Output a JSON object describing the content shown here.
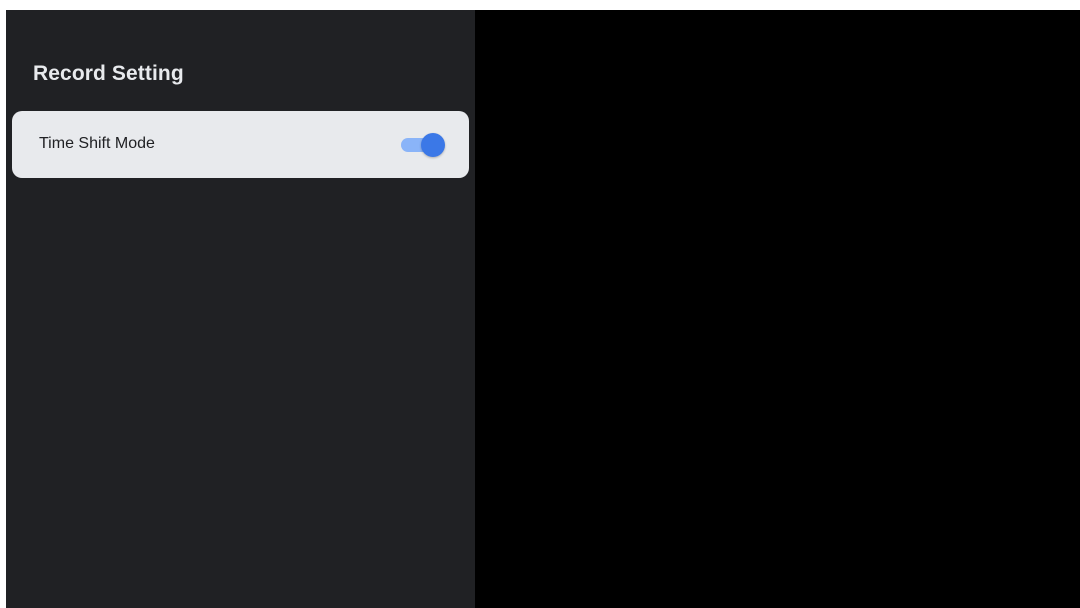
{
  "panel": {
    "title": "Record Setting",
    "settings": [
      {
        "label": "Time Shift Mode",
        "toggle_on": true
      }
    ]
  },
  "colors": {
    "panel_background": "#202124",
    "row_focused_background": "#e8eaed",
    "toggle_track_on": "#8ab4f8",
    "toggle_knob_on": "#3b78e7",
    "preview_background": "#000000"
  },
  "icons": {
    "toggle": "toggle-switch-icon"
  }
}
